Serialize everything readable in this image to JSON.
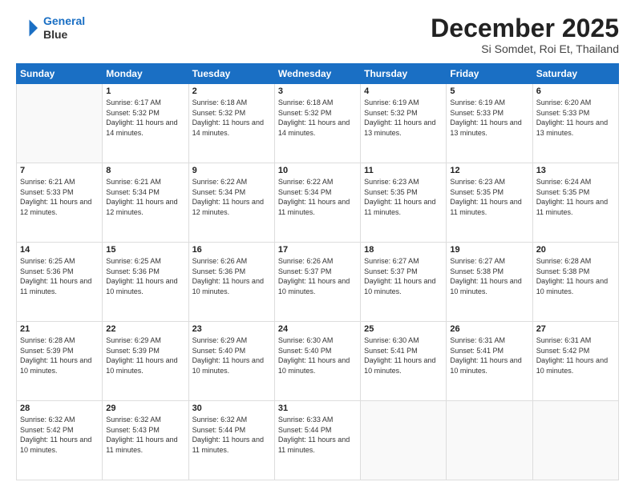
{
  "logo": {
    "line1": "General",
    "line2": "Blue"
  },
  "header": {
    "month": "December 2025",
    "location": "Si Somdet, Roi Et, Thailand"
  },
  "weekdays": [
    "Sunday",
    "Monday",
    "Tuesday",
    "Wednesday",
    "Thursday",
    "Friday",
    "Saturday"
  ],
  "weeks": [
    [
      {
        "day": null
      },
      {
        "day": "1",
        "sunrise": "6:17 AM",
        "sunset": "5:32 PM",
        "daylight": "11 hours and 14 minutes."
      },
      {
        "day": "2",
        "sunrise": "6:18 AM",
        "sunset": "5:32 PM",
        "daylight": "11 hours and 14 minutes."
      },
      {
        "day": "3",
        "sunrise": "6:18 AM",
        "sunset": "5:32 PM",
        "daylight": "11 hours and 14 minutes."
      },
      {
        "day": "4",
        "sunrise": "6:19 AM",
        "sunset": "5:32 PM",
        "daylight": "11 hours and 13 minutes."
      },
      {
        "day": "5",
        "sunrise": "6:19 AM",
        "sunset": "5:33 PM",
        "daylight": "11 hours and 13 minutes."
      },
      {
        "day": "6",
        "sunrise": "6:20 AM",
        "sunset": "5:33 PM",
        "daylight": "11 hours and 13 minutes."
      }
    ],
    [
      {
        "day": "7",
        "sunrise": "6:21 AM",
        "sunset": "5:33 PM",
        "daylight": "11 hours and 12 minutes."
      },
      {
        "day": "8",
        "sunrise": "6:21 AM",
        "sunset": "5:34 PM",
        "daylight": "11 hours and 12 minutes."
      },
      {
        "day": "9",
        "sunrise": "6:22 AM",
        "sunset": "5:34 PM",
        "daylight": "11 hours and 12 minutes."
      },
      {
        "day": "10",
        "sunrise": "6:22 AM",
        "sunset": "5:34 PM",
        "daylight": "11 hours and 11 minutes."
      },
      {
        "day": "11",
        "sunrise": "6:23 AM",
        "sunset": "5:35 PM",
        "daylight": "11 hours and 11 minutes."
      },
      {
        "day": "12",
        "sunrise": "6:23 AM",
        "sunset": "5:35 PM",
        "daylight": "11 hours and 11 minutes."
      },
      {
        "day": "13",
        "sunrise": "6:24 AM",
        "sunset": "5:35 PM",
        "daylight": "11 hours and 11 minutes."
      }
    ],
    [
      {
        "day": "14",
        "sunrise": "6:25 AM",
        "sunset": "5:36 PM",
        "daylight": "11 hours and 11 minutes."
      },
      {
        "day": "15",
        "sunrise": "6:25 AM",
        "sunset": "5:36 PM",
        "daylight": "11 hours and 10 minutes."
      },
      {
        "day": "16",
        "sunrise": "6:26 AM",
        "sunset": "5:36 PM",
        "daylight": "11 hours and 10 minutes."
      },
      {
        "day": "17",
        "sunrise": "6:26 AM",
        "sunset": "5:37 PM",
        "daylight": "11 hours and 10 minutes."
      },
      {
        "day": "18",
        "sunrise": "6:27 AM",
        "sunset": "5:37 PM",
        "daylight": "11 hours and 10 minutes."
      },
      {
        "day": "19",
        "sunrise": "6:27 AM",
        "sunset": "5:38 PM",
        "daylight": "11 hours and 10 minutes."
      },
      {
        "day": "20",
        "sunrise": "6:28 AM",
        "sunset": "5:38 PM",
        "daylight": "11 hours and 10 minutes."
      }
    ],
    [
      {
        "day": "21",
        "sunrise": "6:28 AM",
        "sunset": "5:39 PM",
        "daylight": "11 hours and 10 minutes."
      },
      {
        "day": "22",
        "sunrise": "6:29 AM",
        "sunset": "5:39 PM",
        "daylight": "11 hours and 10 minutes."
      },
      {
        "day": "23",
        "sunrise": "6:29 AM",
        "sunset": "5:40 PM",
        "daylight": "11 hours and 10 minutes."
      },
      {
        "day": "24",
        "sunrise": "6:30 AM",
        "sunset": "5:40 PM",
        "daylight": "11 hours and 10 minutes."
      },
      {
        "day": "25",
        "sunrise": "6:30 AM",
        "sunset": "5:41 PM",
        "daylight": "11 hours and 10 minutes."
      },
      {
        "day": "26",
        "sunrise": "6:31 AM",
        "sunset": "5:41 PM",
        "daylight": "11 hours and 10 minutes."
      },
      {
        "day": "27",
        "sunrise": "6:31 AM",
        "sunset": "5:42 PM",
        "daylight": "11 hours and 10 minutes."
      }
    ],
    [
      {
        "day": "28",
        "sunrise": "6:32 AM",
        "sunset": "5:42 PM",
        "daylight": "11 hours and 10 minutes."
      },
      {
        "day": "29",
        "sunrise": "6:32 AM",
        "sunset": "5:43 PM",
        "daylight": "11 hours and 11 minutes."
      },
      {
        "day": "30",
        "sunrise": "6:32 AM",
        "sunset": "5:44 PM",
        "daylight": "11 hours and 11 minutes."
      },
      {
        "day": "31",
        "sunrise": "6:33 AM",
        "sunset": "5:44 PM",
        "daylight": "11 hours and 11 minutes."
      },
      {
        "day": null
      },
      {
        "day": null
      },
      {
        "day": null
      }
    ]
  ]
}
